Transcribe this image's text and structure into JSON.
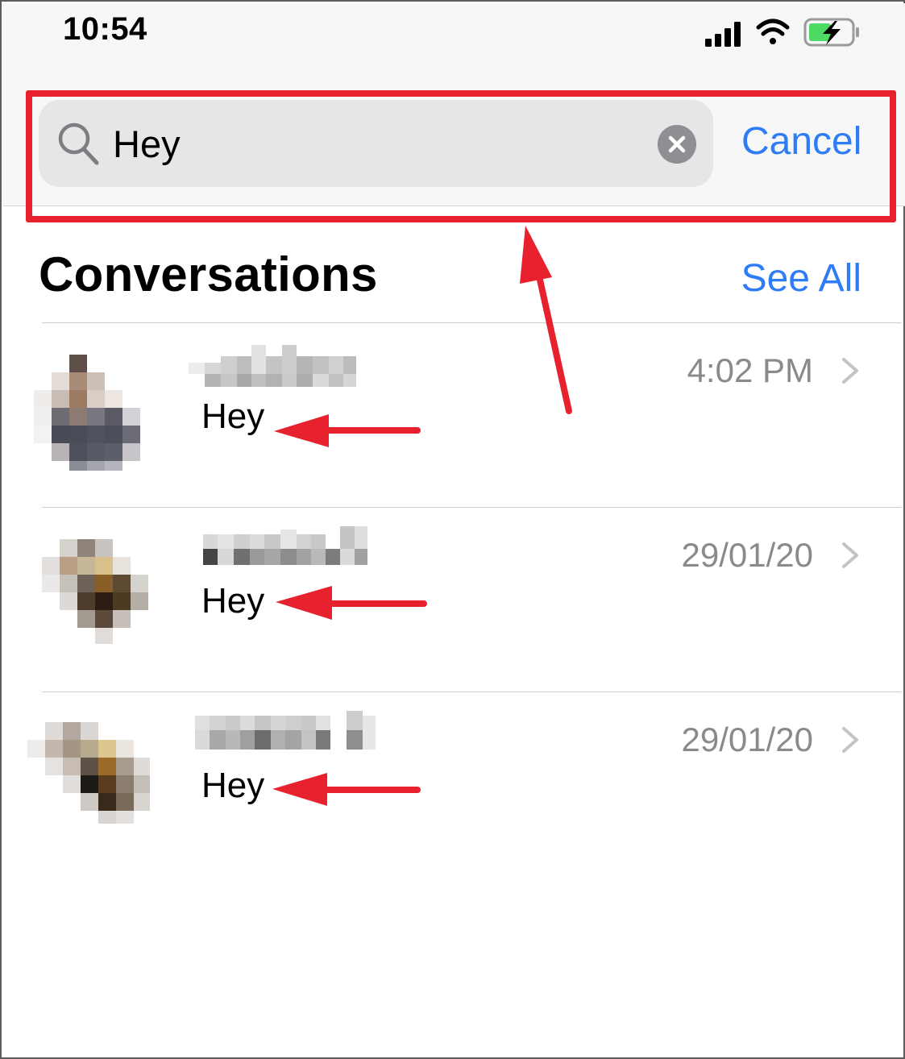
{
  "status_bar": {
    "time": "10:54",
    "icons": [
      "cellular-signal-icon",
      "wifi-icon",
      "battery-charging-icon"
    ]
  },
  "search": {
    "query": "Hey",
    "cancel_label": "Cancel",
    "icon": "search-icon",
    "clear_icon": "clear-circle-icon"
  },
  "conversations": {
    "title": "Conversations",
    "see_all_label": "See All",
    "items": [
      {
        "message": "Hey",
        "timestamp": "4:02 PM"
      },
      {
        "message": "Hey",
        "timestamp": "29/01/20"
      },
      {
        "message": "Hey",
        "timestamp": "29/01/20"
      }
    ]
  },
  "colors": {
    "accent": "#2e7cf6",
    "annotation": "#e8212e",
    "secondary_text": "#8a8a8e",
    "search_field_bg": "#e6e6e6"
  }
}
